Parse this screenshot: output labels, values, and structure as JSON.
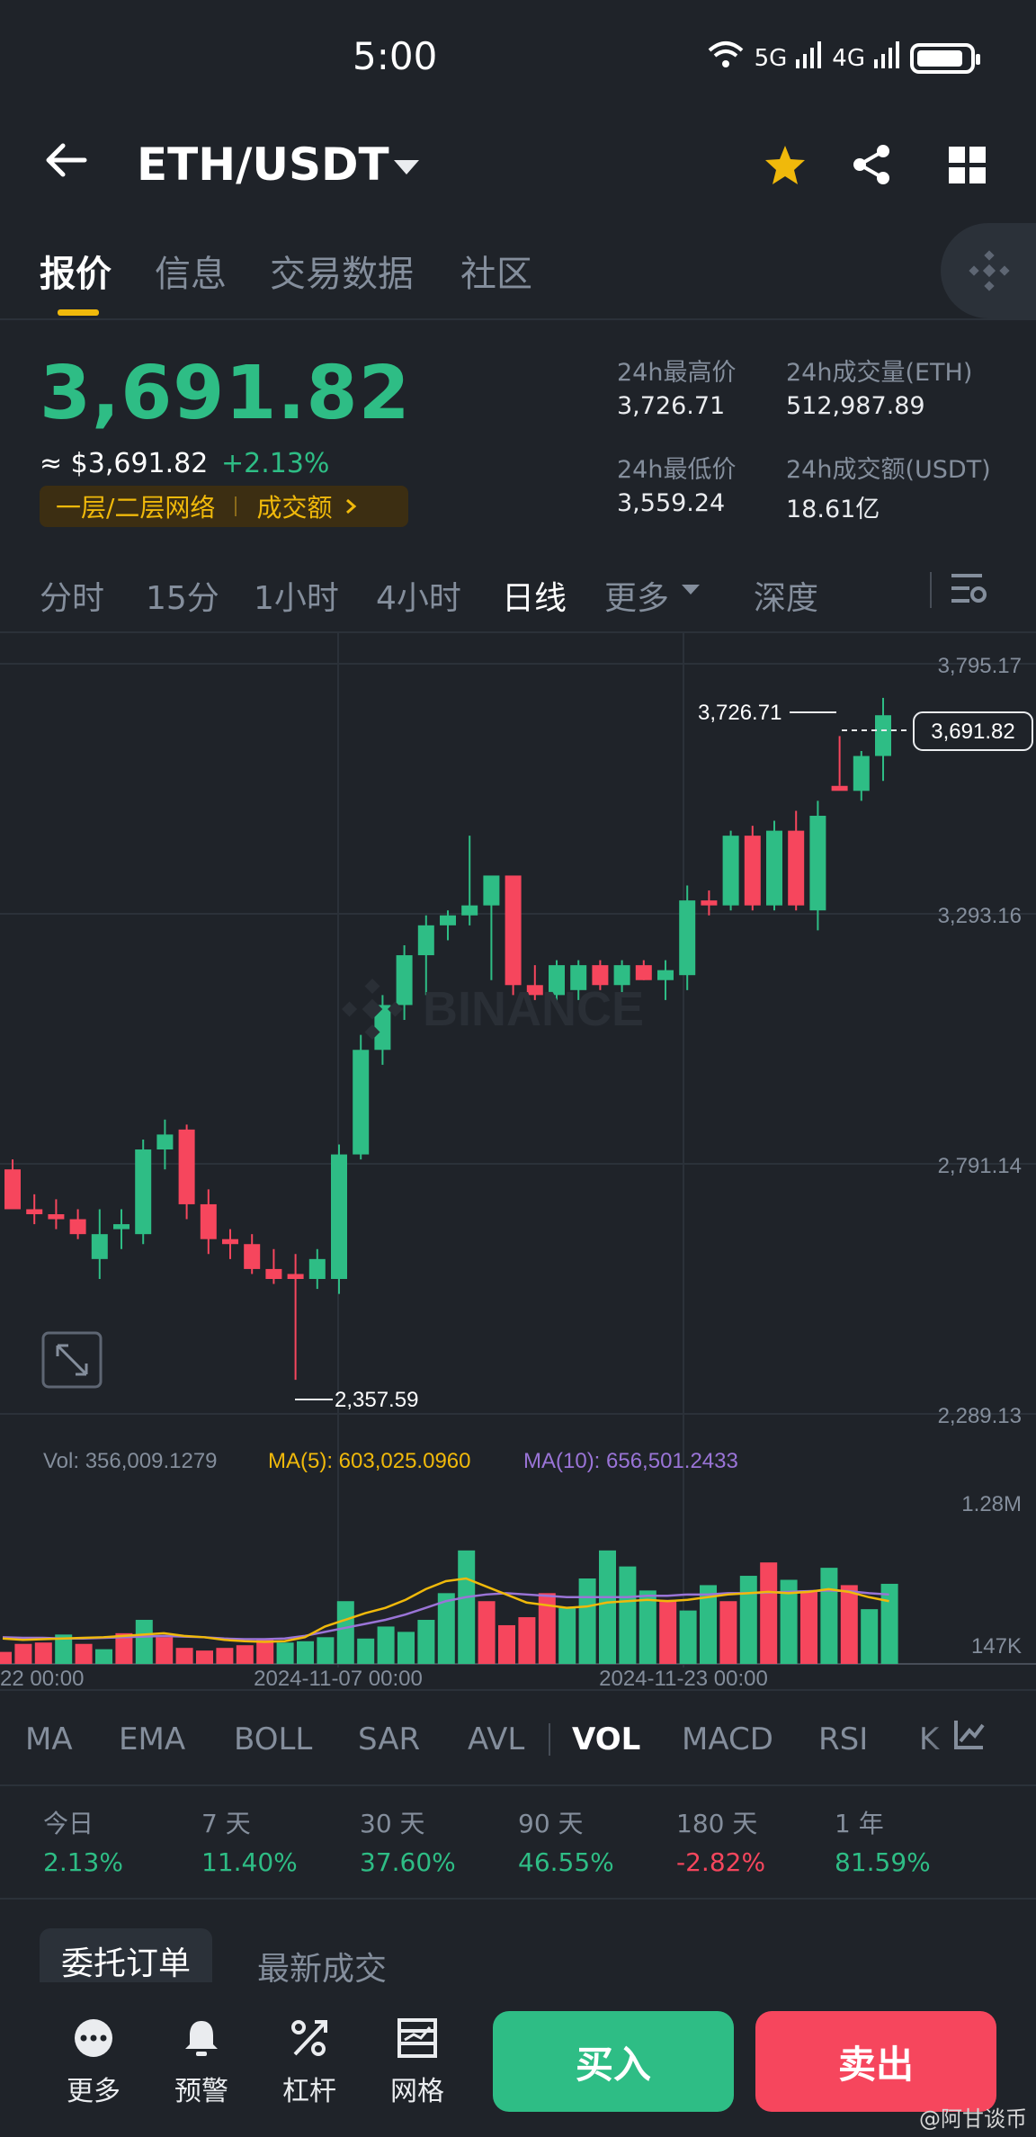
{
  "status_bar": {
    "time": "5:00",
    "network_1": "5G",
    "network_2": "4G"
  },
  "header": {
    "pair": "ETH/USDT",
    "icons": [
      "back-arrow-icon",
      "star-icon",
      "share-icon",
      "grid-icon"
    ]
  },
  "tabs": [
    "报价",
    "信息",
    "交易数据",
    "社区"
  ],
  "price": {
    "last": "3,691.82",
    "usd": "≈ $3,691.82",
    "change": "+2.13%",
    "tag_network": "一层/二层网络",
    "tag_volume": "成交额"
  },
  "stats": {
    "high_label": "24h最高价",
    "high_value": "3,726.71",
    "vol_eth_label": "24h成交量(ETH)",
    "vol_eth_value": "512,987.89",
    "low_label": "24h最低价",
    "low_value": "3,559.24",
    "vol_usdt_label": "24h成交额(USDT)",
    "vol_usdt_value": "18.61亿"
  },
  "intervals": [
    "分时",
    "15分",
    "1小时",
    "4小时",
    "日线",
    "更多",
    "深度"
  ],
  "chart_labels": {
    "y_ticks": [
      "3,795.17",
      "3,293.16",
      "2,791.14",
      "2,289.13"
    ],
    "high_marker": "3,726.71",
    "low_marker": "2,357.59",
    "last_price_box": "3,691.82",
    "watermark": "BINANCE",
    "vol_line": "Vol: 356,009.1279",
    "ma5_line": "MA(5): 603,025.0960",
    "ma10_line": "MA(10): 656,501.2433",
    "vol_ticks": [
      "1.28M",
      "147K"
    ],
    "x_ticks": [
      "22 00:00",
      "2024-11-07 00:00",
      "2024-11-23 00:00"
    ]
  },
  "chart_data": {
    "type": "candlestick",
    "y_range": [
      2289.13,
      3795.17
    ],
    "candles": [
      {
        "o": 2780,
        "h": 2800,
        "l": 2720,
        "c": 2700
      },
      {
        "o": 2700,
        "h": 2730,
        "l": 2670,
        "c": 2690
      },
      {
        "o": 2690,
        "h": 2720,
        "l": 2660,
        "c": 2680
      },
      {
        "o": 2680,
        "h": 2700,
        "l": 2640,
        "c": 2650
      },
      {
        "o": 2600,
        "h": 2700,
        "l": 2560,
        "c": 2650
      },
      {
        "o": 2660,
        "h": 2700,
        "l": 2620,
        "c": 2670
      },
      {
        "o": 2650,
        "h": 2840,
        "l": 2630,
        "c": 2820
      },
      {
        "o": 2820,
        "h": 2880,
        "l": 2780,
        "c": 2850
      },
      {
        "o": 2860,
        "h": 2870,
        "l": 2680,
        "c": 2710
      },
      {
        "o": 2710,
        "h": 2740,
        "l": 2610,
        "c": 2640
      },
      {
        "o": 2640,
        "h": 2660,
        "l": 2600,
        "c": 2630
      },
      {
        "o": 2630,
        "h": 2650,
        "l": 2570,
        "c": 2580
      },
      {
        "o": 2580,
        "h": 2620,
        "l": 2550,
        "c": 2560
      },
      {
        "o": 2570,
        "h": 2610,
        "l": 2357.59,
        "c": 2560
      },
      {
        "o": 2560,
        "h": 2620,
        "l": 2540,
        "c": 2600
      },
      {
        "o": 2560,
        "h": 2830,
        "l": 2530,
        "c": 2810
      },
      {
        "o": 2810,
        "h": 3050,
        "l": 2800,
        "c": 3020
      },
      {
        "o": 3020,
        "h": 3130,
        "l": 2990,
        "c": 3110
      },
      {
        "o": 3110,
        "h": 3230,
        "l": 3080,
        "c": 3210
      },
      {
        "o": 3210,
        "h": 3290,
        "l": 3130,
        "c": 3270
      },
      {
        "o": 3270,
        "h": 3300,
        "l": 3240,
        "c": 3290
      },
      {
        "o": 3290,
        "h": 3450,
        "l": 3270,
        "c": 3310
      },
      {
        "o": 3310,
        "h": 3320,
        "l": 3160,
        "c": 3370
      },
      {
        "o": 3370,
        "h": 3330,
        "l": 3130,
        "c": 3150
      },
      {
        "o": 3150,
        "h": 3190,
        "l": 3120,
        "c": 3130
      },
      {
        "o": 3130,
        "h": 3200,
        "l": 3110,
        "c": 3190
      },
      {
        "o": 3140,
        "h": 3200,
        "l": 3120,
        "c": 3190
      },
      {
        "o": 3190,
        "h": 3200,
        "l": 3140,
        "c": 3150
      },
      {
        "o": 3150,
        "h": 3200,
        "l": 3130,
        "c": 3190
      },
      {
        "o": 3190,
        "h": 3200,
        "l": 3160,
        "c": 3160
      },
      {
        "o": 3160,
        "h": 3200,
        "l": 3120,
        "c": 3180
      },
      {
        "o": 3170,
        "h": 3350,
        "l": 3140,
        "c": 3320
      },
      {
        "o": 3320,
        "h": 3340,
        "l": 3290,
        "c": 3310
      },
      {
        "o": 3310,
        "h": 3460,
        "l": 3300,
        "c": 3450
      },
      {
        "o": 3450,
        "h": 3470,
        "l": 3300,
        "c": 3310
      },
      {
        "o": 3310,
        "h": 3480,
        "l": 3300,
        "c": 3460
      },
      {
        "o": 3460,
        "h": 3500,
        "l": 3300,
        "c": 3310
      },
      {
        "o": 3300,
        "h": 3520,
        "l": 3260,
        "c": 3490
      },
      {
        "o": 3550,
        "h": 3650,
        "l": 3550,
        "c": 3540
      },
      {
        "o": 3540,
        "h": 3620,
        "l": 3520,
        "c": 3610
      },
      {
        "o": 3610,
        "h": 3726.71,
        "l": 3560,
        "c": 3691.82
      }
    ],
    "volume_range": [
      0,
      1280000
    ],
    "volumes": [
      90000,
      150000,
      160000,
      220000,
      150000,
      110000,
      230000,
      330000,
      200000,
      120000,
      100000,
      120000,
      140000,
      180000,
      160000,
      170000,
      200000,
      470000,
      190000,
      280000,
      240000,
      330000,
      530000,
      850000,
      470000,
      290000,
      350000,
      530000,
      420000,
      640000,
      850000,
      730000,
      550000,
      480000,
      400000,
      590000,
      470000,
      660000,
      760000,
      630000,
      540000,
      720000,
      590000,
      410000,
      600000
    ],
    "volume_up": [
      false,
      false,
      false,
      true,
      false,
      true,
      false,
      true,
      false,
      false,
      false,
      false,
      false,
      false,
      true,
      true,
      true,
      true,
      true,
      true,
      true,
      true,
      true,
      true,
      false,
      false,
      false,
      false,
      true,
      true,
      true,
      true,
      true,
      false,
      true,
      true,
      false,
      true,
      false,
      true,
      false,
      true,
      false,
      true,
      true
    ],
    "ma5": [
      190000,
      180000,
      185000,
      190000,
      195000,
      200000,
      210000,
      220000,
      230000,
      210000,
      200000,
      180000,
      170000,
      165000,
      170000,
      200000,
      280000,
      330000,
      380000,
      420000,
      480000,
      560000,
      620000,
      640000,
      580000,
      520000,
      460000,
      440000,
      420000,
      430000,
      460000,
      470000,
      480000,
      470000,
      480000,
      500000,
      520000,
      530000,
      540000,
      530000,
      540000,
      560000,
      540000,
      500000,
      470000
    ],
    "ma10": [
      200000,
      195000,
      195000,
      190000,
      190000,
      195000,
      200000,
      205000,
      210000,
      205000,
      200000,
      190000,
      185000,
      185000,
      190000,
      210000,
      240000,
      270000,
      300000,
      330000,
      370000,
      420000,
      470000,
      500000,
      520000,
      530000,
      520000,
      510000,
      500000,
      500000,
      500000,
      500000,
      510000,
      510000,
      520000,
      520000,
      530000,
      530000,
      535000,
      540000,
      545000,
      550000,
      545000,
      530000,
      520000
    ],
    "vol_range_labels": [
      "147K",
      "1.28M"
    ]
  },
  "indicators": [
    "MA",
    "EMA",
    "BOLL",
    "SAR",
    "AVL",
    "VOL",
    "MACD",
    "RSI",
    "K"
  ],
  "performance": [
    {
      "label": "今日",
      "value": "2.13%",
      "dir": "up"
    },
    {
      "label": "7 天",
      "value": "11.40%",
      "dir": "up"
    },
    {
      "label": "30 天",
      "value": "37.60%",
      "dir": "up"
    },
    {
      "label": "90 天",
      "value": "46.55%",
      "dir": "up"
    },
    {
      "label": "180 天",
      "value": "-2.82%",
      "dir": "down"
    },
    {
      "label": "1 年",
      "value": "81.59%",
      "dir": "up"
    }
  ],
  "orders": {
    "open_orders": "委托订单",
    "latest_trades": "最新成交"
  },
  "bottom_bar": {
    "more": "更多",
    "alert": "预警",
    "leverage": "杠杆",
    "grid": "网格",
    "buy": "买入",
    "sell": "卖出"
  },
  "watermark": "@阿甘谈币",
  "colors": {
    "up": "#2ebd85",
    "down": "#f6465d",
    "accent": "#f0b90b",
    "bg": "#1f2329"
  }
}
